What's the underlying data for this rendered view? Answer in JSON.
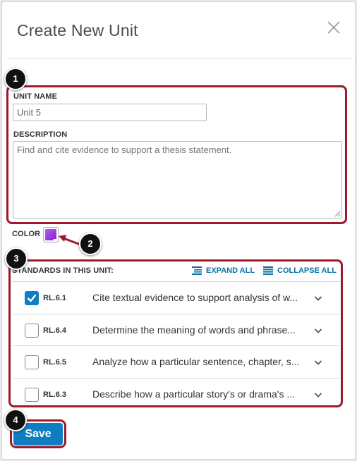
{
  "modal": {
    "title": "Create New Unit"
  },
  "form": {
    "unit_name_label": "UNIT NAME",
    "unit_name_value": "Unit 5",
    "description_label": "DESCRIPTION",
    "description_placeholder": "Find and cite evidence to support a thesis statement.",
    "color_label": "COLOR",
    "color_value": "#8a1fd6"
  },
  "standards": {
    "header": "STANDARDS IN THIS UNIT:",
    "expand_all": "EXPAND ALL",
    "collapse_all": "COLLAPSE ALL",
    "items": [
      {
        "code": "RL.6.1",
        "description": "Cite textual evidence to support analysis of w...",
        "checked": true
      },
      {
        "code": "RL.6.4",
        "description": "Determine the meaning of words and phrase...",
        "checked": false
      },
      {
        "code": "RL.6.5",
        "description": "Analyze how a particular sentence, chapter, s...",
        "checked": false
      },
      {
        "code": "RL.6.3",
        "description": "Describe how a particular story's or drama's ...",
        "checked": false
      }
    ]
  },
  "actions": {
    "save_label": "Save"
  },
  "callouts": {
    "badge_1": "1",
    "badge_2": "2",
    "badge_3": "3",
    "badge_4": "4",
    "color": "#9b1b2a"
  },
  "colors": {
    "accent": "#0e7dc2",
    "link": "#0770a3"
  },
  "icons": {
    "close": "close-icon",
    "expand_all": "expand-all-icon",
    "collapse_all": "collapse-all-icon",
    "chevron": "chevron-down-icon",
    "check": "checkmark-icon"
  }
}
